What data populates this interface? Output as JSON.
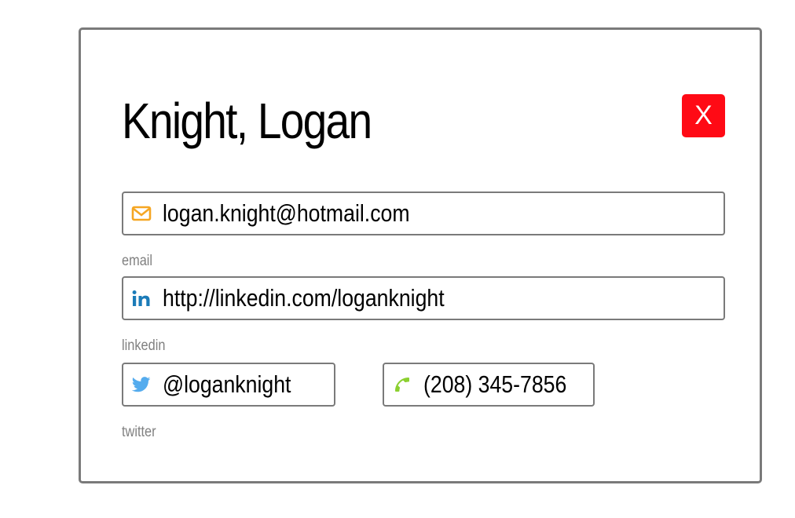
{
  "contact": {
    "name": "Knight, Logan",
    "close_label": "X"
  },
  "fields": {
    "email": {
      "value": "logan.knight@hotmail.com",
      "label": "email",
      "icon": "envelope-icon",
      "color": "#f5a623"
    },
    "linkedin": {
      "value": "http://linkedin.com/loganknight",
      "label": "linkedin",
      "icon": "linkedin-icon",
      "color": "#1b7bb8"
    },
    "twitter": {
      "value": "@loganknight",
      "label": "twitter",
      "icon": "twitter-icon",
      "color": "#55acee"
    },
    "phone": {
      "value": "(208) 345-7856",
      "icon": "phone-icon",
      "color": "#8cd030"
    }
  },
  "colors": {
    "close_button": "#ff0a15",
    "border": "#7a7a7a",
    "label": "#808080"
  }
}
